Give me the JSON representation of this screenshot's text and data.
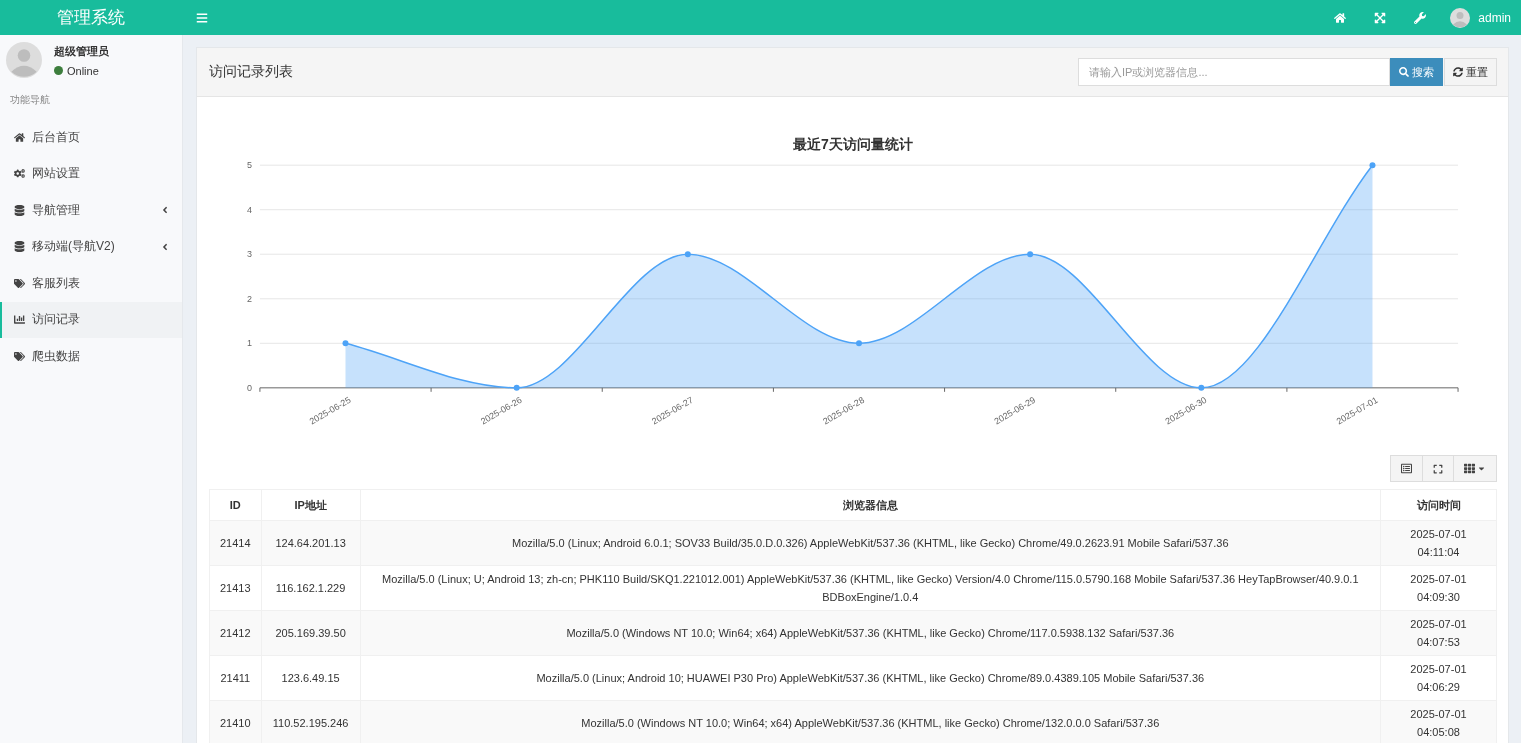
{
  "app": {
    "title": "管理系统",
    "user": "admin"
  },
  "sidebar": {
    "user_name": "超级管理员",
    "status": "Online",
    "section": "功能导航",
    "items": [
      {
        "label": "后台首页",
        "has_submenu": false,
        "selected": false
      },
      {
        "label": "网站设置",
        "has_submenu": false,
        "selected": false
      },
      {
        "label": "导航管理",
        "has_submenu": true,
        "selected": false
      },
      {
        "label": "移动端(导航V2)",
        "has_submenu": true,
        "selected": false
      },
      {
        "label": "客服列表",
        "has_submenu": false,
        "selected": false
      },
      {
        "label": "访问记录",
        "has_submenu": false,
        "selected": true
      },
      {
        "label": "爬虫数据",
        "has_submenu": false,
        "selected": false
      }
    ]
  },
  "panel": {
    "title": "访问记录列表",
    "search": {
      "placeholder": "请输入IP或浏览器信息..."
    },
    "search_button": "搜索",
    "reset_button": "重置",
    "chart_data": {
      "type": "area",
      "title": "最近7天访问量统计",
      "categories": [
        "2025-06-25",
        "2025-06-26",
        "2025-06-27",
        "2025-06-28",
        "2025-06-29",
        "2025-06-30",
        "2025-07-01"
      ],
      "series": [
        {
          "color": "#4da3f7",
          "values": [
            1,
            0,
            3,
            1,
            3,
            0,
            5
          ]
        }
      ],
      "grid": true,
      "ylim": [
        0,
        5
      ],
      "yticks": [
        0,
        1,
        2,
        3,
        4,
        5
      ]
    },
    "table": {
      "columns": [
        "ID",
        "IP地址",
        "浏览器信息",
        "访问时间"
      ],
      "rows": [
        {
          "id": "21414",
          "ip": "124.64.201.13",
          "browser": "Mozilla/5.0 (Linux; Android 6.0.1; SOV33 Build/35.0.D.0.326) AppleWebKit/537.36 (KHTML, like Gecko) Chrome/49.0.2623.91 Mobile Safari/537.36",
          "date": "2025-07-01",
          "time": "04:11:04"
        },
        {
          "id": "21413",
          "ip": "116.162.1.229",
          "browser": "Mozilla/5.0 (Linux; U; Android 13; zh-cn; PHK110 Build/SKQ1.221012.001) AppleWebKit/537.36 (KHTML, like Gecko) Version/4.0 Chrome/115.0.5790.168 Mobile Safari/537.36 HeyTapBrowser/40.9.0.1 BDBoxEngine/1.0.4",
          "date": "2025-07-01",
          "time": "04:09:30"
        },
        {
          "id": "21412",
          "ip": "205.169.39.50",
          "browser": "Mozilla/5.0 (Windows NT 10.0; Win64; x64) AppleWebKit/537.36 (KHTML, like Gecko) Chrome/117.0.5938.132 Safari/537.36",
          "date": "2025-07-01",
          "time": "04:07:53"
        },
        {
          "id": "21411",
          "ip": "123.6.49.15",
          "browser": "Mozilla/5.0 (Linux; Android 10; HUAWEI P30 Pro) AppleWebKit/537.36 (KHTML, like Gecko) Chrome/89.0.4389.105 Mobile Safari/537.36",
          "date": "2025-07-01",
          "time": "04:06:29"
        },
        {
          "id": "21410",
          "ip": "110.52.195.246",
          "browser": "Mozilla/5.0 (Windows NT 10.0; Win64; x64) AppleWebKit/537.36 (KHTML, like Gecko) Chrome/132.0.0.0 Safari/537.36",
          "date": "2025-07-01",
          "time": "04:05:08"
        }
      ]
    }
  }
}
